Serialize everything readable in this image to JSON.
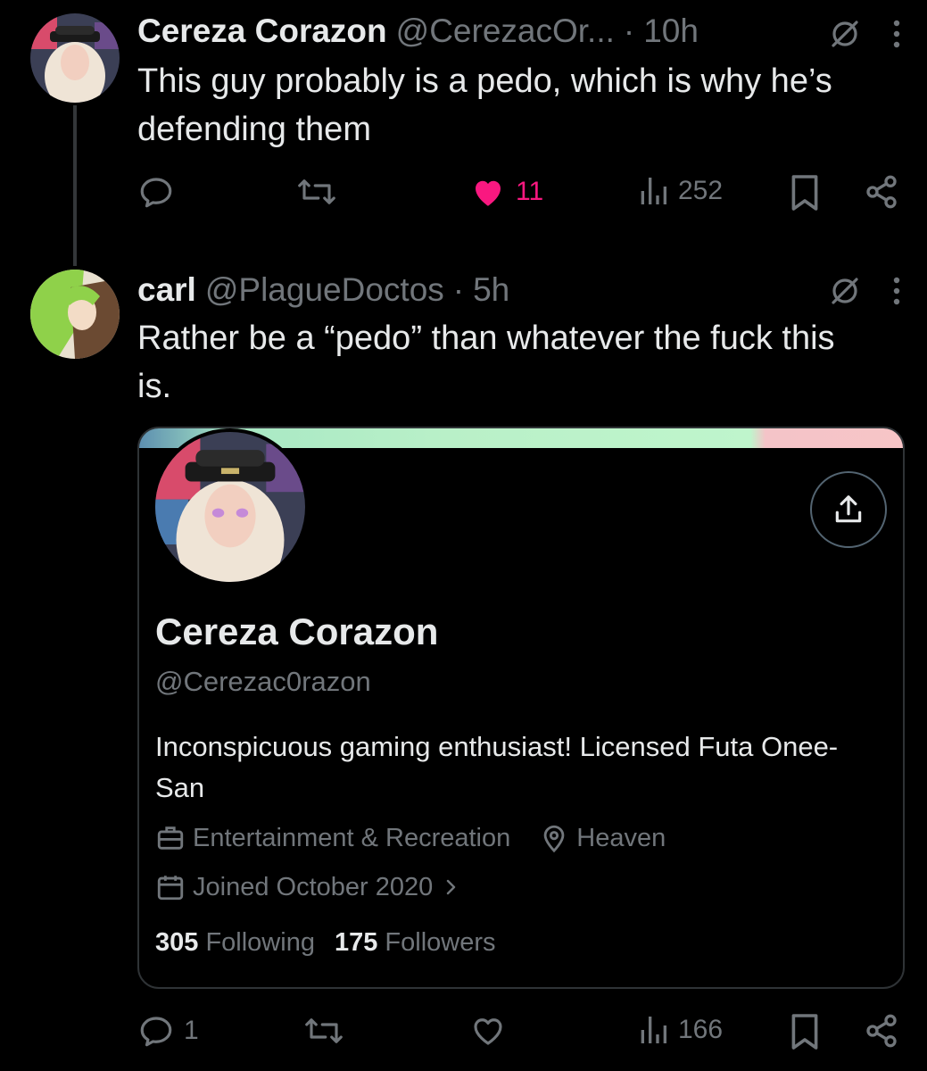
{
  "tweet1": {
    "name": "Cereza Corazon",
    "handle": "@CerezacOr...",
    "dot": "·",
    "time": "10h",
    "text": "This guy probably is a pedo, which is why he’s defending them",
    "likes": "11",
    "views": "252"
  },
  "tweet2": {
    "name": "carl",
    "handle": "@PlagueDoctos",
    "dot": "·",
    "time": "5h",
    "text": "Rather be a “pedo” than whatever the fuck this is.",
    "replies": "1",
    "views": "166"
  },
  "profile_card": {
    "name": "Cereza Corazon",
    "handle": "@Cerezac0razon",
    "bio": "Inconspicuous gaming enthusiast! Licensed Futa Onee-San",
    "category": "Entertainment & Recreation",
    "location": "Heaven",
    "joined": "Joined October 2020",
    "following_count": "305",
    "following_label": "Following",
    "followers_count": "175",
    "followers_label": "Followers"
  },
  "colors": {
    "background": "#000000",
    "text_primary": "#e7e9ea",
    "text_secondary": "#71767b",
    "like_active": "#f91880",
    "border": "#2f3336"
  },
  "icons": [
    "reply-icon",
    "retweet-icon",
    "heart-icon",
    "views-icon",
    "bookmark-icon",
    "share-icon",
    "grok-icon",
    "more-icon",
    "upload-icon",
    "briefcase-icon",
    "location-icon",
    "calendar-icon",
    "chevron-right-icon"
  ]
}
